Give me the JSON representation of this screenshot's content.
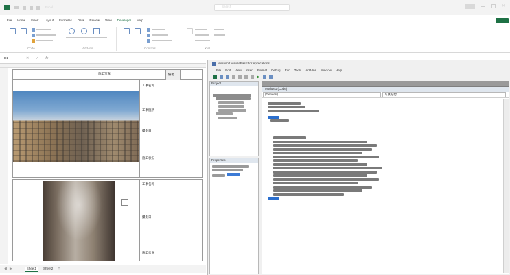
{
  "excel": {
    "title_faint": "Excel",
    "search_faint": "Search",
    "user_badge": "",
    "ribbon_tabs": [
      "File",
      "Home",
      "Insert",
      "Layout",
      "Formulas",
      "Data",
      "Review",
      "View",
      "Developer",
      "Help"
    ],
    "ribbon_groups": [
      "Code",
      "Add-ins",
      "Controls",
      "XML"
    ],
    "formula_namebox": "D1",
    "sheet_header_title": "施工写真",
    "sheet_header_right": "備考",
    "right_cells_top": [
      "工事名称",
      "工事箇所",
      "撮影日",
      "施工状況"
    ],
    "right_cells_bottom": [
      "工事名称",
      "撮影日",
      "施工状況"
    ],
    "sheet_tabs": [
      "Sheet1",
      "Sheet2"
    ]
  },
  "vbe": {
    "window_title": "Microsoft Visual Basic for Applications",
    "menu": [
      "File",
      "Edit",
      "View",
      "Insert",
      "Format",
      "Debug",
      "Run",
      "Tools",
      "Add-Ins",
      "Window",
      "Help"
    ],
    "project_title": "Project",
    "properties_title": "Properties",
    "module_title": "Module1 (Code)",
    "combo_left": "(General)",
    "combo_right": "写真貼付"
  }
}
